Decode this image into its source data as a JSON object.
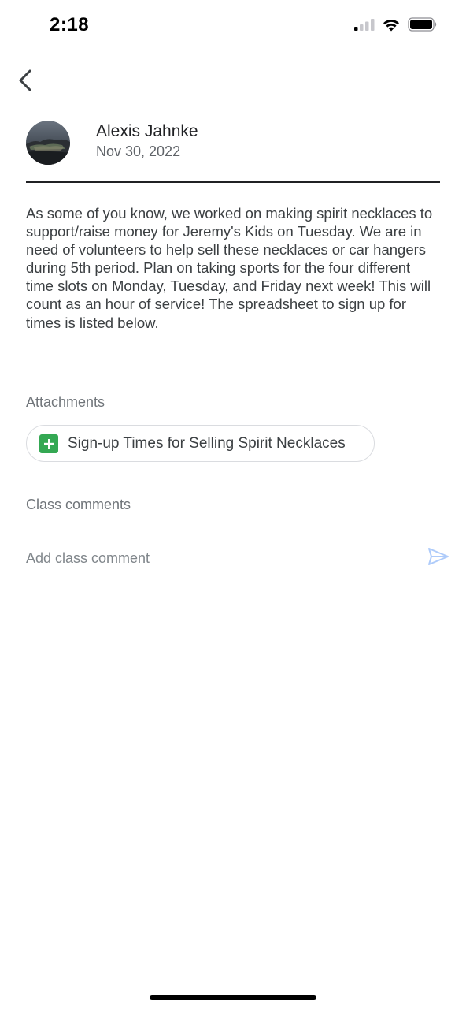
{
  "status_bar": {
    "time": "2:18",
    "icons": [
      "cellular-signal-icon",
      "wifi-icon",
      "battery-icon"
    ]
  },
  "post": {
    "author": "Alexis Jahnke",
    "date": "Nov 30, 2022",
    "body": "As some of you know, we worked on making spirit necklaces to support/raise money for Jeremy's Kids on Tuesday. We are in need of volunteers to help sell these necklaces or car hangers during 5th period. Plan on taking sports for the four different time slots on Monday, Tuesday, and Friday next week! This will count as an hour of service! The spreadsheet to sign up for times is listed below."
  },
  "attachments": {
    "label": "Attachments",
    "items": [
      {
        "title": "Sign-up Times for Selling Spirit Necklaces",
        "icon": "google-sheets-icon",
        "color": "#34a853"
      }
    ]
  },
  "comments": {
    "label": "Class comments",
    "input_placeholder": "Add class comment",
    "send_icon": "send-icon",
    "send_color": "#aecbfa"
  }
}
